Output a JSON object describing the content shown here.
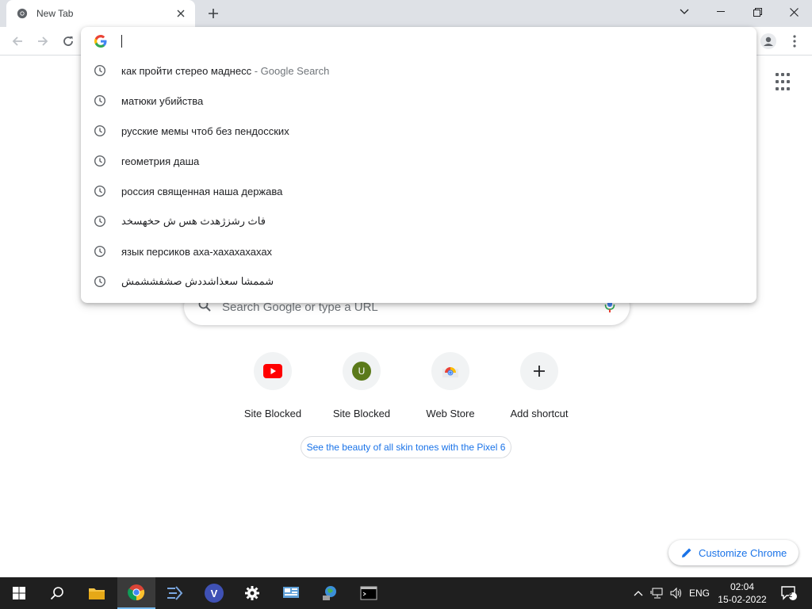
{
  "tab": {
    "title": "New Tab"
  },
  "window_controls": {
    "tab_search": "chevron-down-icon",
    "minimize": "minimize-icon",
    "maximize": "restore-icon",
    "close": "close-icon"
  },
  "omnibox": {
    "input_value": "",
    "suggestions": [
      {
        "text": "как пройти стерео маднесс",
        "suffix": " - Google Search"
      },
      {
        "text": "матюки убийства",
        "suffix": ""
      },
      {
        "text": "русские мемы чтоб без пендосских",
        "suffix": ""
      },
      {
        "text": "геометрия даша",
        "suffix": ""
      },
      {
        "text": "россия священная наша держава",
        "suffix": ""
      },
      {
        "text": "فاث رشزژهدث هس ش حخهسخد",
        "suffix": ""
      },
      {
        "text": "язык персиков аха-хахахахахах",
        "suffix": ""
      },
      {
        "text": "شممشا سعذاشددش صشفششمش",
        "suffix": ""
      }
    ]
  },
  "ntp": {
    "search_placeholder": "Search Google or type a URL",
    "shortcuts": [
      {
        "label": "Site Blocked",
        "icon": "youtube-icon"
      },
      {
        "label": "Site Blocked",
        "icon": "u-letter-icon",
        "letter": "U"
      },
      {
        "label": "Web Store",
        "icon": "web-store-icon"
      },
      {
        "label": "Add shortcut",
        "icon": "plus-icon"
      }
    ],
    "promo": "See the beauty of all skin tones with the Pixel 6",
    "customize_label": "Customize Chrome"
  },
  "taskbar": {
    "language": "ENG",
    "time": "02:04",
    "date": "15-02-2022",
    "notification_count": "2"
  },
  "colors": {
    "accent": "#1a73e8",
    "youtube_red": "#ff0000",
    "u_avatar": "#5b7a1a",
    "taskbar_bg": "#1f1f1f"
  }
}
